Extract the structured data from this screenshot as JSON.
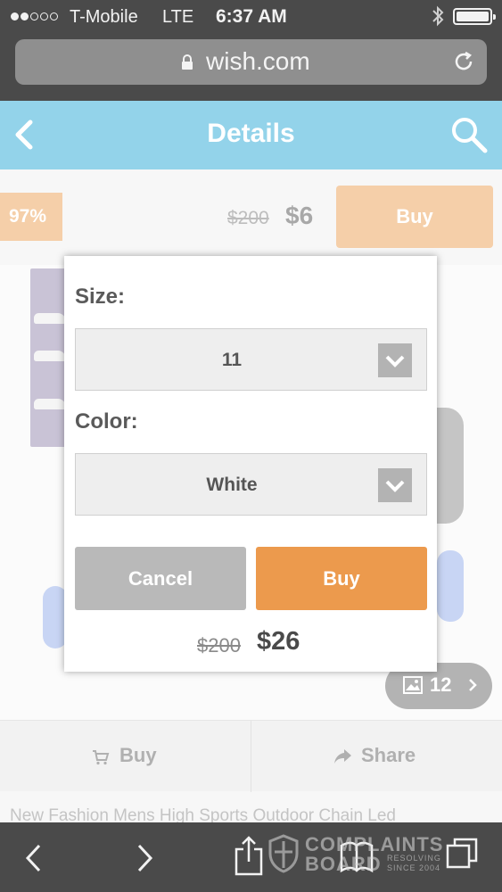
{
  "status_bar": {
    "carrier": "T-Mobile",
    "network": "LTE",
    "time": "6:37 AM",
    "signal_bars_filled": 2,
    "signal_bars_total": 5,
    "battery_level": 1.0
  },
  "browser": {
    "url": "wish.com"
  },
  "header": {
    "title": "Details"
  },
  "product": {
    "discount": "97%",
    "original_price": "$200",
    "price": "$6",
    "buy_label": "Buy",
    "image_count": "12",
    "title_partial": "New Fashion Mens High Sports Outdoor Chain Led"
  },
  "actions": {
    "buy_label": "Buy",
    "share_label": "Share"
  },
  "dialog": {
    "size_label": "Size:",
    "size_value": "11",
    "color_label": "Color:",
    "color_value": "White",
    "cancel_label": "Cancel",
    "buy_label": "Buy",
    "original_price": "$200",
    "price": "$26"
  },
  "watermark": {
    "line1": "COMPLAINTS",
    "line2": "BOARD",
    "tagline_1": "RESOLVING",
    "tagline_2": "SINCE 2004"
  },
  "colors": {
    "header_bg": "#93d3ea",
    "buy_accent": "#ec9a4d",
    "cancel_gray": "#b9b9b9",
    "browser_chrome": "#4a4a4a"
  }
}
